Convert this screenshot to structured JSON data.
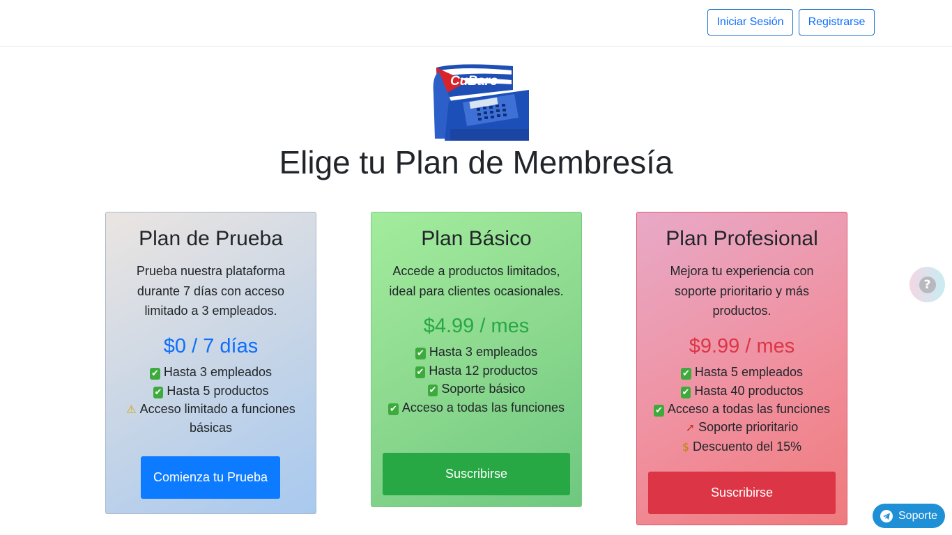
{
  "header": {
    "login_label": "Iniciar Sesión",
    "register_label": "Registrarse"
  },
  "logo": {
    "text": "CuBaro"
  },
  "page_title": "Elige tu Plan de Membresía",
  "plans": [
    {
      "title": "Plan de Prueba",
      "description": "Prueba nuestra plataforma durante 7 días con acceso limitado a 3 empleados.",
      "price": "$0 / 7 días",
      "features": [
        {
          "icon": "check-icon",
          "text": "Hasta 3 empleados"
        },
        {
          "icon": "check-icon",
          "text": "Hasta 5 productos"
        },
        {
          "icon": "warning-icon",
          "text": "Acceso limitado a funciones básicas"
        }
      ],
      "button_label": "Comienza tu Prueba",
      "accent_color": "#0d6efd"
    },
    {
      "title": "Plan Básico",
      "description": "Accede a productos limitados, ideal para clientes ocasionales.",
      "price": "$4.99 / mes",
      "features": [
        {
          "icon": "check-icon",
          "text": "Hasta 3 empleados"
        },
        {
          "icon": "check-icon",
          "text": "Hasta 12 productos"
        },
        {
          "icon": "check-icon",
          "text": "Soporte básico"
        },
        {
          "icon": "check-icon",
          "text": "Acceso a todas las funciones"
        }
      ],
      "button_label": "Suscribirse",
      "accent_color": "#28a745"
    },
    {
      "title": "Plan Profesional",
      "description": "Mejora tu experiencia con soporte prioritario y más productos.",
      "price": "$9.99 / mes",
      "features": [
        {
          "icon": "check-icon",
          "text": "Hasta 5 empleados"
        },
        {
          "icon": "check-icon",
          "text": "Hasta 40 productos"
        },
        {
          "icon": "check-icon",
          "text": "Acceso a todas las funciones"
        },
        {
          "icon": "rocket-icon",
          "text": "Soporte prioritario"
        },
        {
          "icon": "money-bag-icon",
          "text": "Descuento del 15%"
        }
      ],
      "button_label": "Suscribirse",
      "accent_color": "#dc3545"
    }
  ],
  "help_fab": {
    "icon": "question-icon",
    "glyph": "?"
  },
  "support": {
    "label": "Soporte",
    "icon": "telegram-icon"
  }
}
